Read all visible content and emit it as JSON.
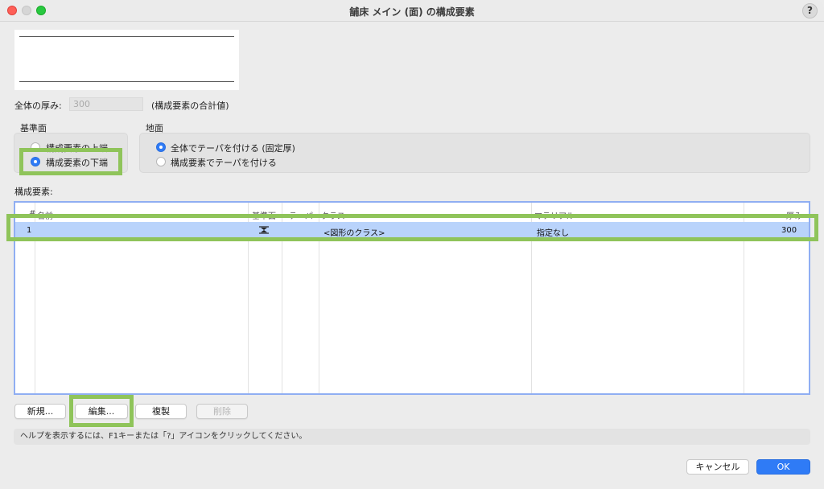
{
  "window": {
    "title": "舗床 メイン (面) の構成要素",
    "help_label": "?"
  },
  "thickness": {
    "label": "全体の厚み:",
    "value": "300",
    "note": "(構成要素の合計値)"
  },
  "reference": {
    "title": "基準面",
    "options": [
      {
        "label": "構成要素の上端",
        "selected": false
      },
      {
        "label": "構成要素の下端",
        "selected": true
      }
    ]
  },
  "ground": {
    "title": "地面",
    "options": [
      {
        "label": "全体でテーパを付ける (固定厚)",
        "selected": true
      },
      {
        "label": "構成要素でテーパを付ける",
        "selected": false
      }
    ]
  },
  "components": {
    "label": "構成要素:",
    "columns": [
      "#",
      "名前",
      "基準面",
      "テーパ",
      "クラス",
      "マテリアル",
      "厚み"
    ],
    "rows": [
      {
        "index": "1",
        "name": "",
        "reference_icon": "datum-symbol-icon",
        "taper": "",
        "class": "<図形のクラス>",
        "material": "指定なし",
        "thickness": "300"
      }
    ]
  },
  "buttons": {
    "new": "新規...",
    "edit": "編集...",
    "duplicate": "複製",
    "delete": "削除"
  },
  "status": "ヘルプを表示するには、F1キーまたは「?」アイコンをクリックしてください。",
  "footer": {
    "cancel": "キャンセル",
    "ok": "OK"
  },
  "colors": {
    "accent": "#2f7bf6",
    "highlight": "#8fc45a",
    "selection": "#b9d3fb"
  }
}
